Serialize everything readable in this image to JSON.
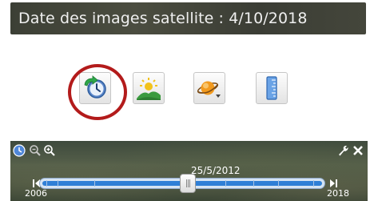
{
  "date_banner": {
    "text": "Date des images satellite : 4/10/2018"
  },
  "toolbar": {
    "buttons": [
      {
        "name": "historical-imagery-button",
        "icon": "clock-history-icon"
      },
      {
        "name": "sunlight-button",
        "icon": "sun-landscape-icon"
      },
      {
        "name": "planet-switch-button",
        "icon": "planet-icon"
      },
      {
        "name": "ruler-button",
        "icon": "ruler-icon"
      }
    ],
    "highlighted": "historical-imagery-button",
    "highlight_color": "#b31b1b"
  },
  "time_slider": {
    "current_date": "25/5/2012",
    "start_year": "2006",
    "end_year": "2018",
    "position": 0.52,
    "accent_color": "#2f7fd6"
  }
}
